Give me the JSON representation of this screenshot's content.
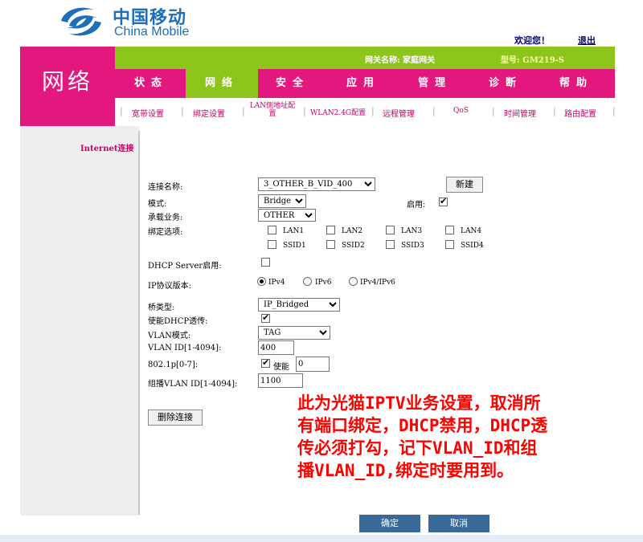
{
  "brand": {
    "name_cn": "中国移动",
    "name_en": "China Mobile"
  },
  "header": {
    "welcome": "欢迎您！",
    "logout": "退出"
  },
  "section_title": "网络",
  "gateway": {
    "name": "网关名称: 家庭网关",
    "model": "型号: GM219-S"
  },
  "tabs": [
    {
      "label": "状态"
    },
    {
      "label": "网络"
    },
    {
      "label": "安全"
    },
    {
      "label": "应用"
    },
    {
      "label": "管理"
    },
    {
      "label": "诊断"
    },
    {
      "label": "帮助"
    }
  ],
  "active_tab": "网络",
  "subnav": [
    {
      "label": "宽带设置"
    },
    {
      "label": "绑定设置"
    },
    {
      "label": "LAN侧地址配置"
    },
    {
      "label": "WLAN2.4G配置"
    },
    {
      "label": "远程管理"
    },
    {
      "label": "QoS"
    },
    {
      "label": "时间管理"
    },
    {
      "label": "路由配置"
    }
  ],
  "left_nav": {
    "internet": "Internet连接"
  },
  "form": {
    "connection_name_label": "连接名称:",
    "connection_name_value": "3_OTHER_B_VID_400",
    "new_button": "新建",
    "mode_label": "模式:",
    "mode_value": "Bridge",
    "enable_label": "启用:",
    "service_label": "承载业务:",
    "service_value": "OTHER",
    "binding_label": "绑定选项:",
    "ports": [
      "LAN1",
      "LAN2",
      "LAN3",
      "LAN4",
      "SSID1",
      "SSID2",
      "SSID3",
      "SSID4"
    ],
    "dhcp_server_label": "DHCP Server启用:",
    "ip_version_label": "IP协议版本:",
    "ip_options": [
      "IPv4",
      "IPv6",
      "IPv4/IPv6"
    ],
    "ip_selected": "IPv4",
    "bridge_type_label": "桥类型:",
    "bridge_type_value": "IP_Bridged",
    "dhcp_passthrough_label": "使能DHCP透传:",
    "vlan_mode_label": "VLAN模式:",
    "vlan_mode_value": "TAG",
    "vlan_id_label": "VLAN ID[1-4094]:",
    "vlan_id_value": "400",
    "priority_label": "802.1p[0-7]:",
    "priority_enable_label": "使能",
    "priority_value": "0",
    "multicast_vlan_label": "组播VLAN ID[1-4094]:",
    "multicast_vlan_value": "1100",
    "delete_button": "删除连接"
  },
  "annotation": {
    "line1": "此为光猫IPTV业务设置，取消所",
    "line2": "有端口绑定，DHCP禁用，DHCP透",
    "line3": "传必须打勾，记下VLAN_ID和组",
    "line4": "播VLAN_ID,绑定时要用到。"
  },
  "footer": {
    "ok_button": "确定",
    "cancel_button": "取消"
  },
  "colors": {
    "magenta": "#e2187f",
    "green": "#8ec51b",
    "brand_blue": "#1c6fb8",
    "annotation_red": "#ff0000"
  }
}
